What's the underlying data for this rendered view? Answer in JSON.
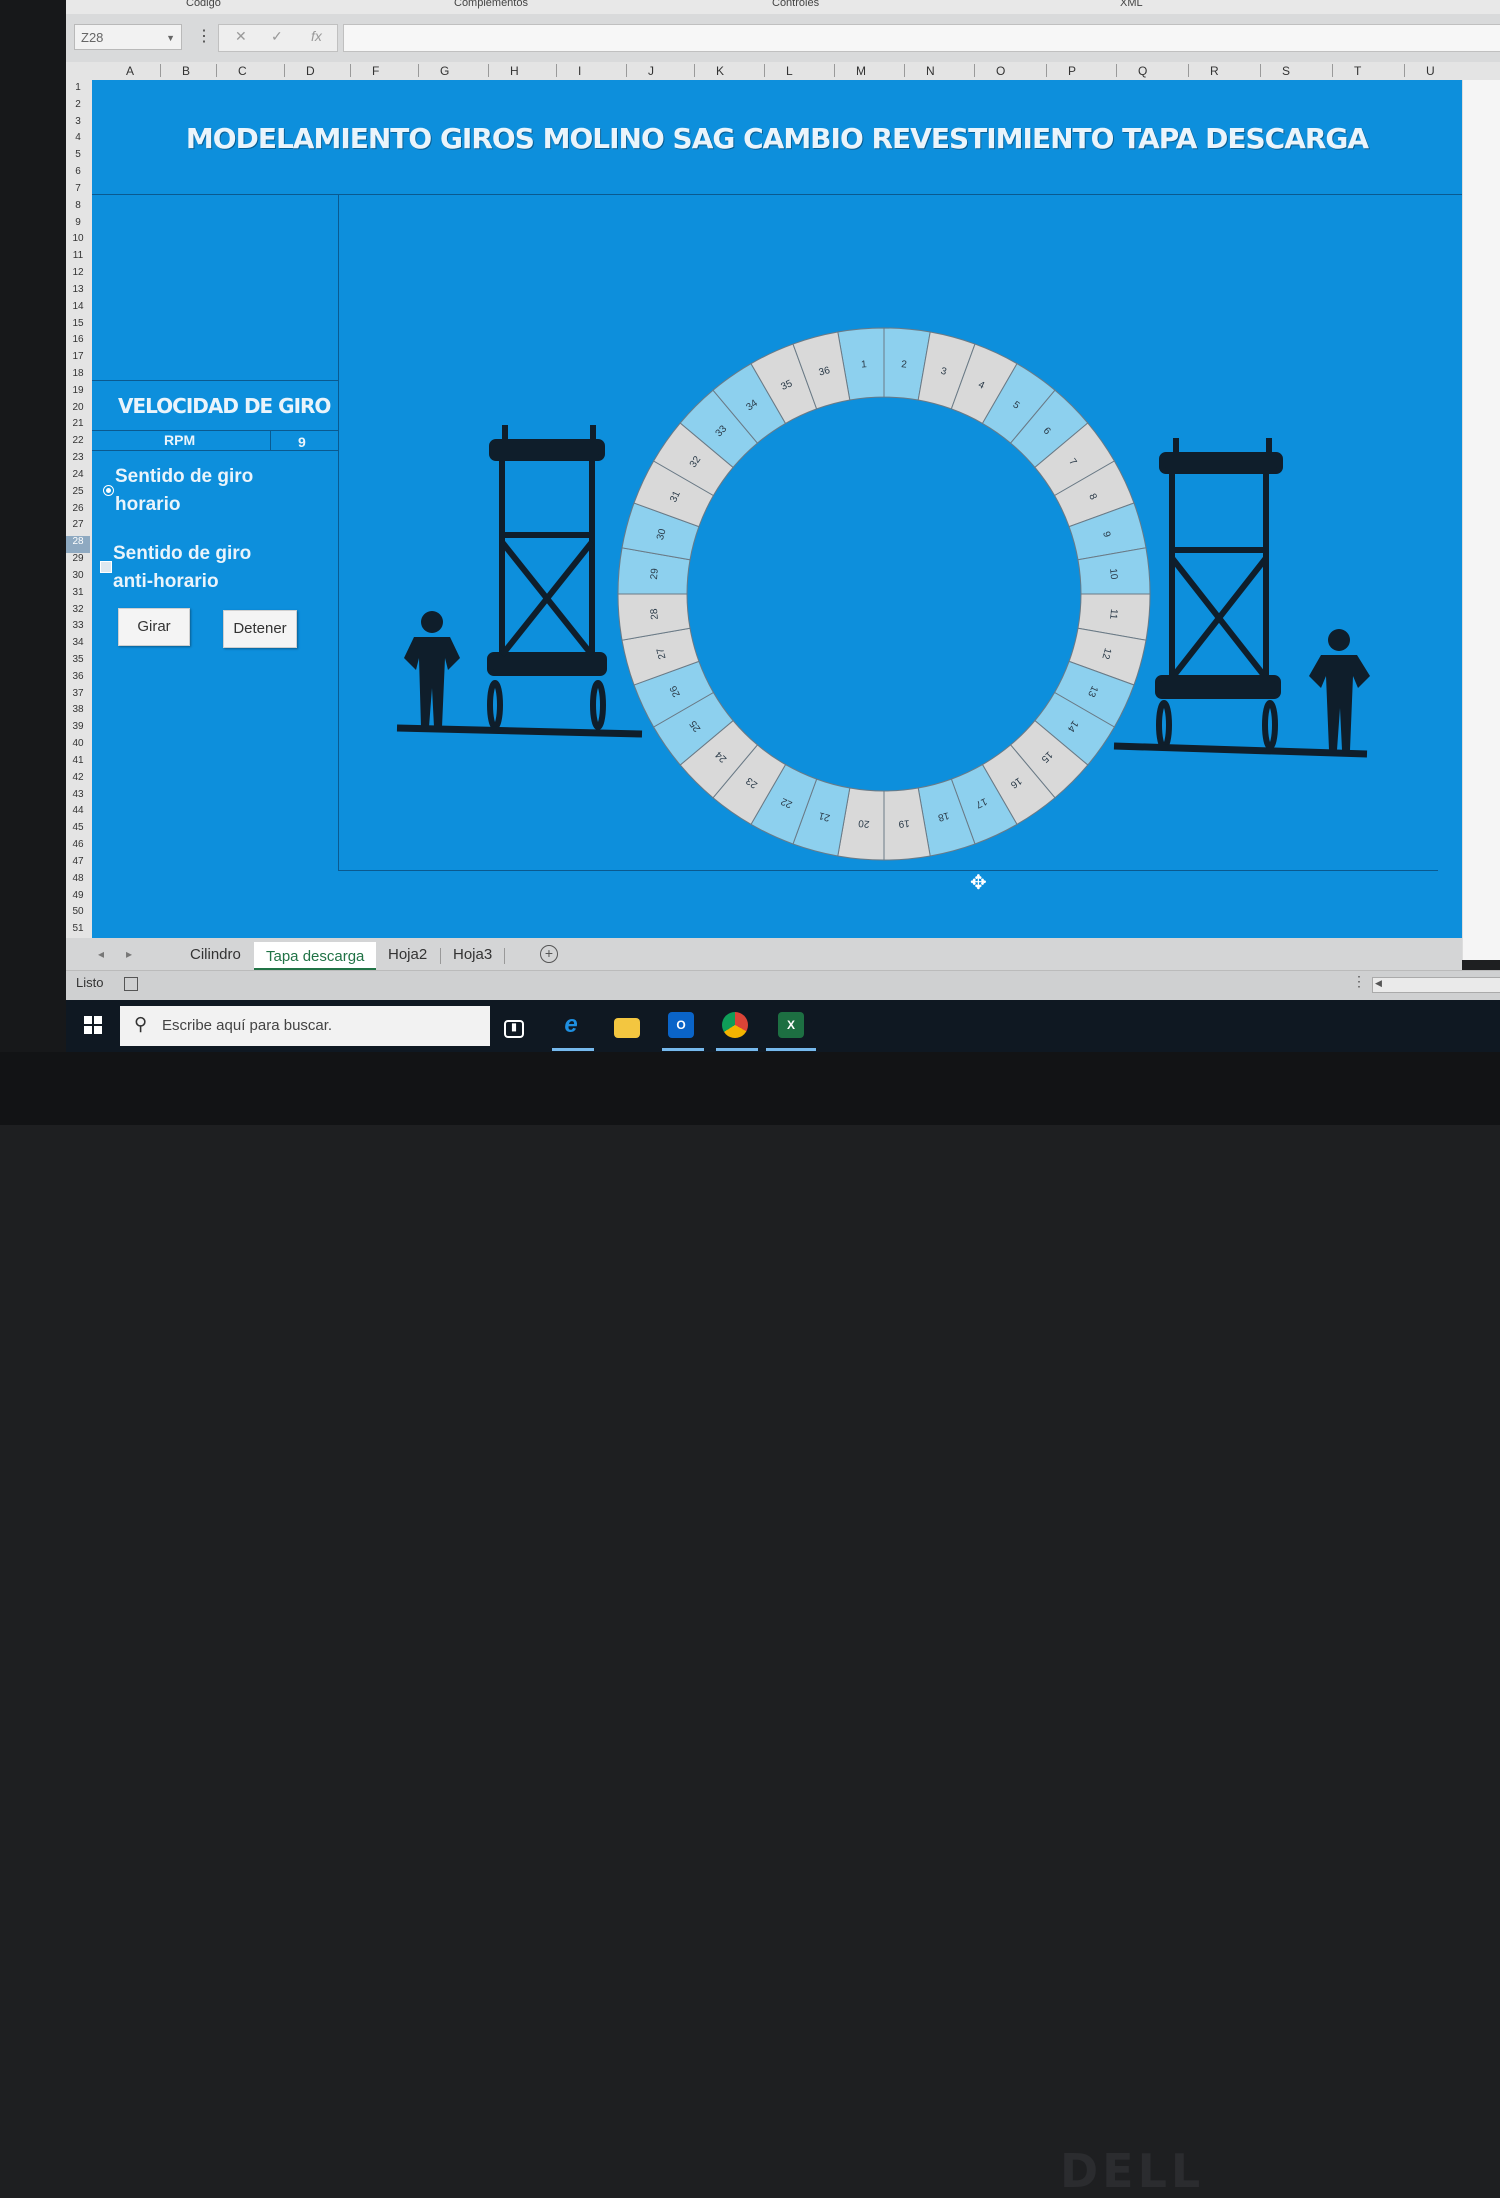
{
  "ribbon": {
    "tabs": [
      "Código",
      "Complementos",
      "Controles",
      "XML"
    ]
  },
  "formula_bar": {
    "name_box": "Z28",
    "cancel_icon": "✕",
    "enter_icon": "✓",
    "fx_icon": "fx",
    "value": ""
  },
  "columns": [
    "A",
    "B",
    "C",
    "D",
    "F",
    "G",
    "H",
    "I",
    "J",
    "K",
    "L",
    "M",
    "N",
    "O",
    "P",
    "Q",
    "R",
    "S",
    "T",
    "U"
  ],
  "rows": [
    "1",
    "2",
    "3",
    "4",
    "5",
    "6",
    "7",
    "8",
    "9",
    "10",
    "11",
    "12",
    "13",
    "14",
    "15",
    "16",
    "17",
    "18",
    "19",
    "20",
    "21",
    "22",
    "23",
    "24",
    "25",
    "26",
    "27",
    "28",
    "29",
    "30",
    "31",
    "32",
    "33",
    "34",
    "35",
    "36",
    "37",
    "38",
    "39",
    "40",
    "41",
    "42",
    "43",
    "44",
    "45",
    "46",
    "47",
    "48",
    "49",
    "50",
    "51"
  ],
  "selected_row": "28",
  "sheet": {
    "title": "MODELAMIENTO GIROS MOLINO SAG CAMBIO REVESTIMIENTO TAPA DESCARGA",
    "panel": {
      "heading": "VELOCIDAD DE GIRO",
      "rpm_label": "RPM",
      "rpm_value": "9",
      "option_cw_line1": "Sentido de giro",
      "option_cw_line2": "horario",
      "option_ccw_line1": "Sentido de giro",
      "option_ccw_line2": "anti-horario",
      "button_spin": "Girar",
      "button_stop": "Detener"
    },
    "ring_segments": [
      "1",
      "2",
      "3",
      "4",
      "5",
      "6",
      "7",
      "8",
      "9",
      "10",
      "11",
      "12",
      "13",
      "14",
      "15",
      "16",
      "17",
      "18",
      "19",
      "20",
      "21",
      "22",
      "23",
      "24",
      "25",
      "26",
      "27",
      "28",
      "29",
      "30",
      "31",
      "32",
      "33",
      "34",
      "35",
      "36"
    ],
    "colors": {
      "background": "#0d8fdc",
      "segment_blue": "#8dd0ee",
      "segment_grey": "#d9d9d9",
      "figure": "#0f1e2b"
    }
  },
  "sheet_tabs": [
    "Cilindro",
    "Tapa descarga",
    "Hoja2",
    "Hoja3"
  ],
  "active_tab": "Tapa descarga",
  "status": {
    "ready": "Listo"
  },
  "taskbar": {
    "search_placeholder": "Escribe aquí para buscar.",
    "apps": [
      "task-view-icon",
      "internet-explorer-icon",
      "file-explorer-icon",
      "outlook-icon",
      "chrome-icon",
      "excel-icon"
    ]
  },
  "monitor_brand": "DELL"
}
